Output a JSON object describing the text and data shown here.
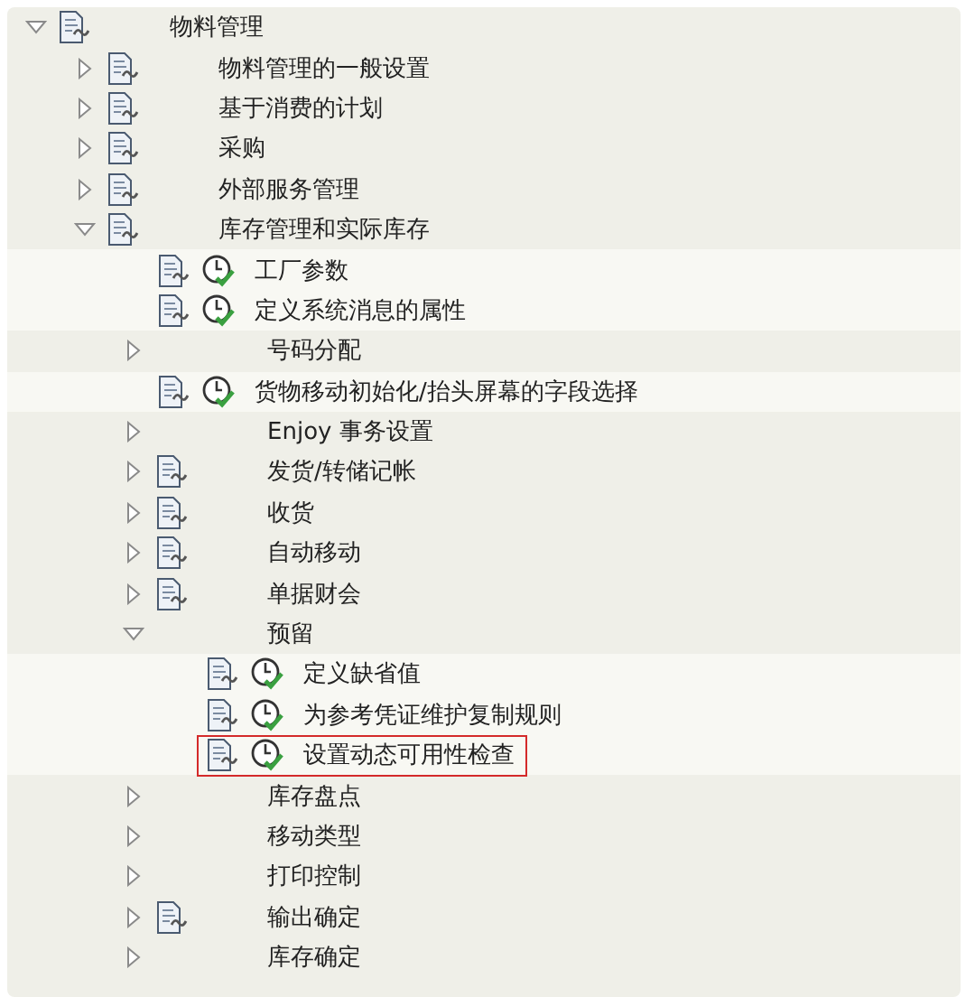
{
  "tree": [
    {
      "kind": "folder",
      "label": "物料管理",
      "expanded": true,
      "doc": true,
      "children": [
        {
          "kind": "folder",
          "label": "物料管理的一般设置",
          "expanded": false,
          "doc": true
        },
        {
          "kind": "folder",
          "label": "基于消费的计划",
          "expanded": false,
          "doc": true
        },
        {
          "kind": "folder",
          "label": "采购",
          "expanded": false,
          "doc": true
        },
        {
          "kind": "folder",
          "label": "外部服务管理",
          "expanded": false,
          "doc": true
        },
        {
          "kind": "folder",
          "label": "库存管理和实际库存",
          "expanded": true,
          "doc": true,
          "children": [
            {
              "kind": "activity",
              "label": "工厂参数",
              "selected": false
            },
            {
              "kind": "activity",
              "label": "定义系统消息的属性",
              "selected": false
            },
            {
              "kind": "folder",
              "label": "号码分配",
              "expanded": false,
              "doc": false
            },
            {
              "kind": "activity",
              "label": "货物移动初始化/抬头屏幕的字段选择",
              "selected": false
            },
            {
              "kind": "folder",
              "label": "Enjoy 事务设置",
              "expanded": false,
              "doc": false
            },
            {
              "kind": "folder",
              "label": "发货/转储记帐",
              "expanded": false,
              "doc": true
            },
            {
              "kind": "folder",
              "label": "收货",
              "expanded": false,
              "doc": true
            },
            {
              "kind": "folder",
              "label": "自动移动",
              "expanded": false,
              "doc": true
            },
            {
              "kind": "folder",
              "label": "单据财会",
              "expanded": false,
              "doc": true
            },
            {
              "kind": "folder",
              "label": "预留",
              "expanded": true,
              "doc": false,
              "children": [
                {
                  "kind": "activity",
                  "label": "定义缺省值",
                  "selected": false
                },
                {
                  "kind": "activity",
                  "label": "为参考凭证维护复制规则",
                  "selected": false
                },
                {
                  "kind": "activity",
                  "label": "设置动态可用性检查",
                  "selected": true
                }
              ]
            },
            {
              "kind": "folder",
              "label": "库存盘点",
              "expanded": false,
              "doc": false
            },
            {
              "kind": "folder",
              "label": "移动类型",
              "expanded": false,
              "doc": false
            },
            {
              "kind": "folder",
              "label": "打印控制",
              "expanded": false,
              "doc": false
            },
            {
              "kind": "folder",
              "label": "输出确定",
              "expanded": false,
              "doc": true
            },
            {
              "kind": "folder",
              "label": "库存确定",
              "expanded": false,
              "doc": false
            }
          ]
        }
      ]
    }
  ]
}
